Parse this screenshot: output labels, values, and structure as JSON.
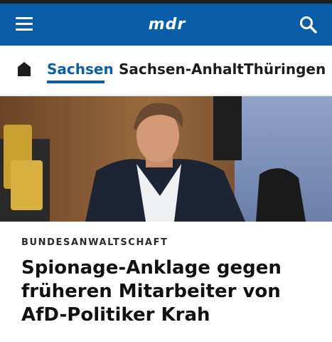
{
  "header": {
    "logo_text": "mdr",
    "brand_color": "#0a5ea8",
    "menu_icon": "hamburger-menu-icon",
    "search_icon": "search-icon"
  },
  "nav": {
    "home_icon": "home-icon",
    "items": [
      {
        "label": "Sachsen",
        "active": true
      },
      {
        "label": "Sachsen-Anhalt",
        "active": false
      },
      {
        "label": "Thüringen",
        "active": false
      }
    ]
  },
  "article": {
    "kicker": "BUNDESANWALTSCHAFT",
    "headline": "Spionage-Anklage gegen früheren Mitarbeiter von AfD-Politiker Krah"
  }
}
